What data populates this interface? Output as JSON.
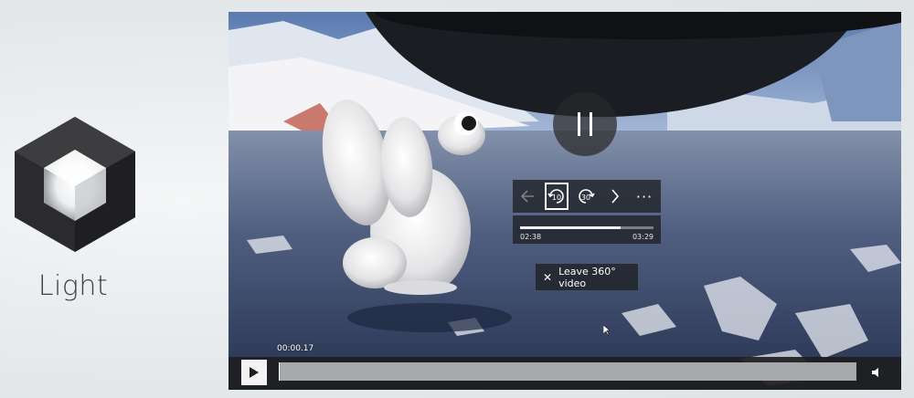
{
  "theme": {
    "label": "Light"
  },
  "player": {
    "time_current": "02:38",
    "time_total": "03:29",
    "progress_fraction": 0.756,
    "elapsed": "00:00.17",
    "seek_fraction": 0.002,
    "rewind_label": "10",
    "forward_label": "30",
    "leave_360": "Leave 360° video"
  },
  "icons": {
    "back": "back-arrow-icon",
    "rewind": "rewind-10-icon",
    "forward": "forward-30-icon",
    "next": "chevron-right-icon",
    "more": "more-icon",
    "pause": "pause-icon",
    "play": "play-icon",
    "volume": "volume-icon",
    "close": "close-icon"
  },
  "colors": {
    "accent": "#ffffff",
    "panel": "#1e2024"
  }
}
